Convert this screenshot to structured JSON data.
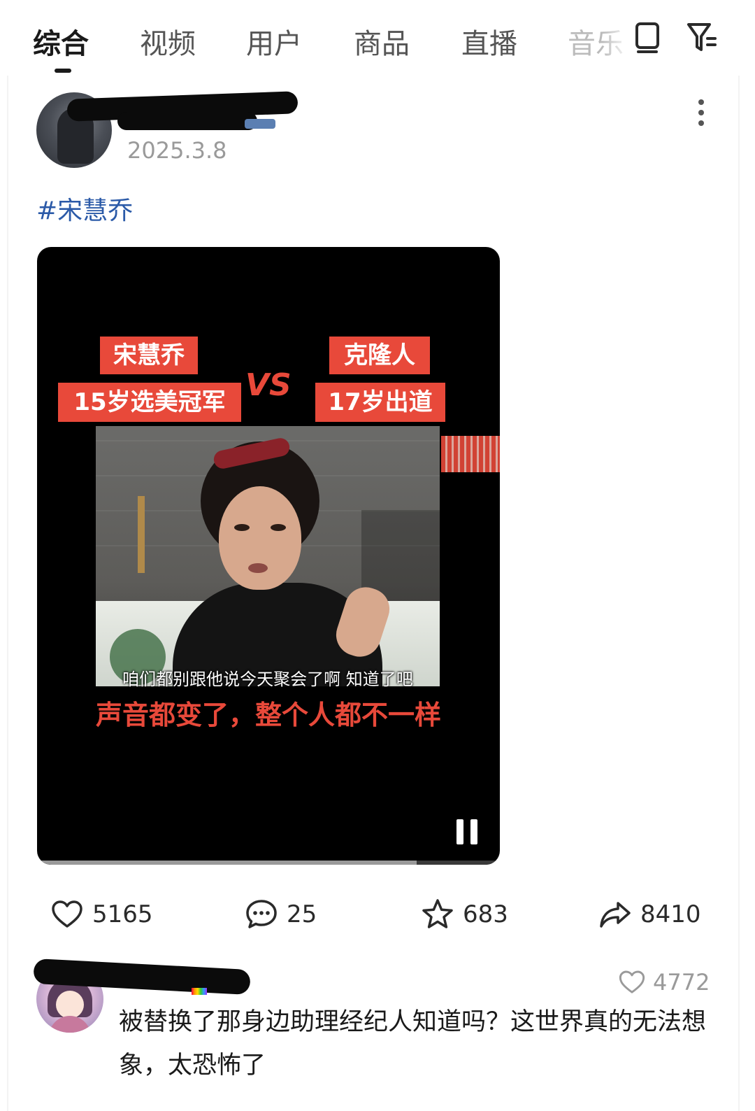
{
  "tabs": [
    {
      "label": "综合",
      "active": true
    },
    {
      "label": "视频"
    },
    {
      "label": "用户"
    },
    {
      "label": "商品"
    },
    {
      "label": "直播"
    },
    {
      "label": "音乐",
      "partially_hidden": true
    }
  ],
  "toolbar_icons": [
    "tablet-icon",
    "filter-icon"
  ],
  "post": {
    "date": "2025.3.8",
    "hashtag": "#宋慧乔",
    "video": {
      "left_label_1": "宋慧乔",
      "left_label_2": "15岁选美冠军",
      "vs": "VS",
      "right_label_1": "克隆人",
      "right_label_2": "17岁出道",
      "subtitle": "咱们都别跟他说今天聚会了啊 知道了吧",
      "caption": "声音都变了，整个人都不一样",
      "progress": 0.82,
      "playing": true
    },
    "actions": {
      "likes": "5165",
      "comments": "25",
      "favorites": "683",
      "shares": "8410"
    }
  },
  "comment": {
    "likes": "4772",
    "text": "被替换了那身边助理经纪人知道吗？这世界真的无法想象，太恐怖了"
  },
  "colors": {
    "accent_red": "#e8493a",
    "hashtag_blue": "#2b5aa8",
    "text_primary": "#1a1a1a",
    "text_secondary": "#9a9a9a"
  }
}
